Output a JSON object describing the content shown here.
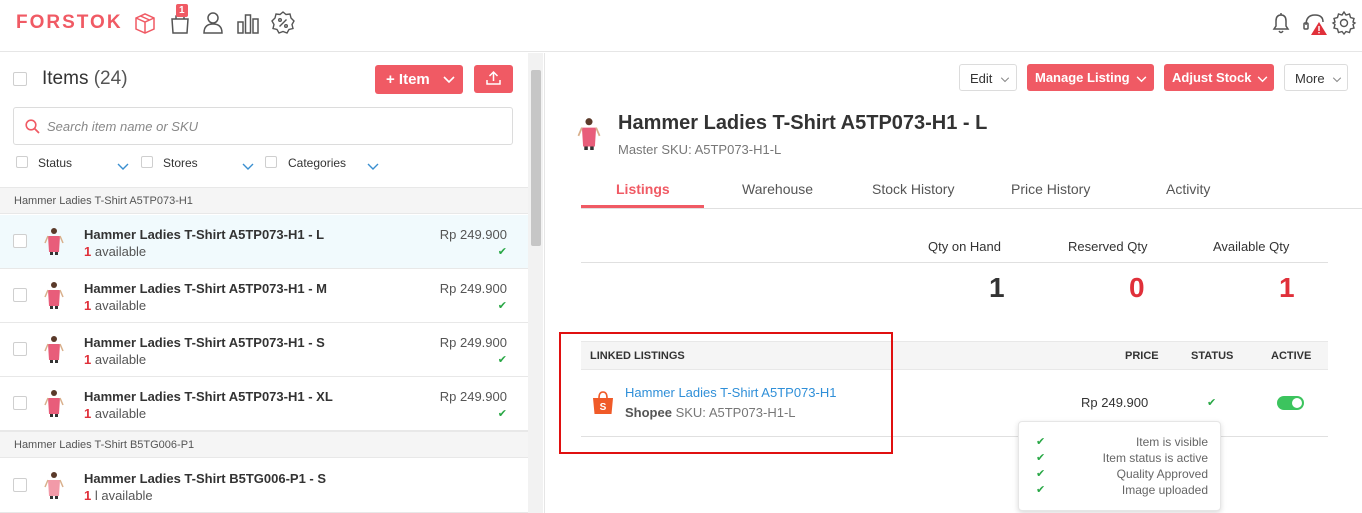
{
  "app": {
    "logo": "FORSTOK",
    "notification_count": "1"
  },
  "left_panel": {
    "title": "Items",
    "count": "(24)",
    "add_item_label": "+ Item",
    "search_placeholder": "Search item name or SKU",
    "filters": [
      "Status",
      "Stores",
      "Categories"
    ],
    "groups": [
      {
        "name": "Hammer Ladies T-Shirt A5TP073-H1",
        "rows": [
          {
            "name": "Hammer Ladies T-Shirt A5TP073-H1 - L",
            "qty": "1",
            "avail": " available",
            "price": "Rp 249.900"
          },
          {
            "name": "Hammer Ladies T-Shirt A5TP073-H1 - M",
            "qty": "1",
            "avail": " available",
            "price": "Rp 249.900"
          },
          {
            "name": "Hammer Ladies T-Shirt A5TP073-H1 - S",
            "qty": "1",
            "avail": " available",
            "price": "Rp 249.900"
          },
          {
            "name": "Hammer Ladies T-Shirt A5TP073-H1 - XL",
            "qty": "1",
            "avail": " available",
            "price": "Rp 249.900"
          }
        ]
      },
      {
        "name": "Hammer Ladies T-Shirt B5TG006-P1",
        "rows": [
          {
            "name": "Hammer Ladies T-Shirt B5TG006-P1 - S",
            "qty": "1",
            "avail": " l available",
            "price": ""
          }
        ]
      }
    ]
  },
  "toolbar": {
    "edit": "Edit",
    "manage_listing": "Manage Listing",
    "adjust_stock": "Adjust Stock",
    "more": "More"
  },
  "product": {
    "title": "Hammer Ladies T-Shirt A5TP073-H1 - L",
    "master_sku": "Master SKU: A5TP073-H1-L"
  },
  "tabs": [
    "Listings",
    "Warehouse",
    "Stock History",
    "Price History",
    "Activity"
  ],
  "quantities": {
    "qty_on_hand_label": "Qty on Hand",
    "qty_on_hand": "1",
    "reserved_label": "Reserved Qty",
    "reserved": "0",
    "available_label": "Available Qty",
    "available": "1"
  },
  "linked_listings": {
    "header": "LINKED LISTINGS",
    "price_header": "PRICE",
    "status_header": "STATUS",
    "active_header": "ACTIVE",
    "listing": {
      "name": "Hammer Ladies T-Shirt A5TP073-H1",
      "store": "Shopee",
      "sku": " SKU: A5TP073-H1-L",
      "price": "Rp  249.900",
      "active": true
    }
  },
  "tooltip": [
    "Item is visible",
    "Item status is active",
    "Quality Approved",
    "Image uploaded"
  ],
  "colors": {
    "brand": "#f05a64",
    "link": "#2f8fd8",
    "success": "#28a745",
    "danger": "#e0303a",
    "highlight": "#e01010"
  }
}
